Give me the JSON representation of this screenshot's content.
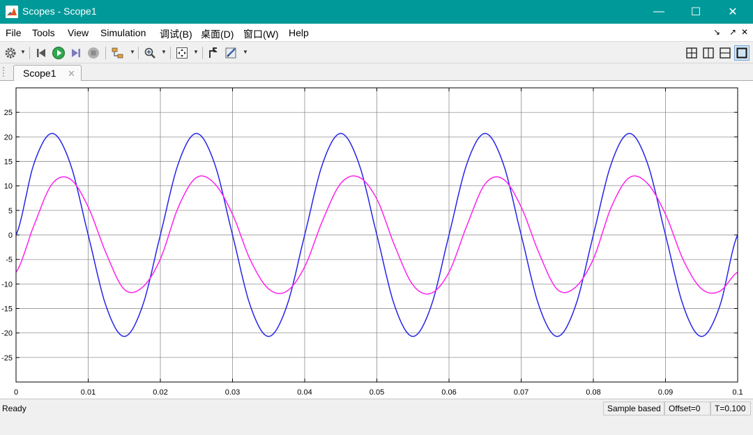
{
  "window": {
    "title": "Scopes - Scope1",
    "minimize_glyph": "—",
    "maximize_glyph": "☐",
    "close_glyph": "✕",
    "accent_color": "#009999"
  },
  "menu": {
    "items": [
      "File",
      "Tools",
      "View",
      "Simulation",
      "调试(B)",
      "桌面(D)",
      "窗口(W)",
      "Help"
    ],
    "right_glyphs": [
      "↘",
      "↗",
      "✕"
    ]
  },
  "toolbar": {
    "icons": [
      "gear-icon",
      "step-back-icon",
      "run-icon",
      "step-forward-icon",
      "stop-icon",
      "highlight-icon",
      "zoom-icon",
      "fit-to-view-icon",
      "triggers-icon",
      "measurements-icon"
    ],
    "layout_icons": [
      "layout-2x2-icon",
      "layout-columns-icon",
      "layout-rows-icon",
      "layout-single-icon"
    ]
  },
  "tab": {
    "label": "Scope1",
    "close_glyph": "✕"
  },
  "status": {
    "ready": "Ready",
    "sample_mode": "Sample based",
    "offset": "Offset=0",
    "time": "T=0.100"
  },
  "chart_data": {
    "type": "line",
    "title": "",
    "xlabel": "",
    "ylabel": "",
    "xlim": [
      0,
      0.1
    ],
    "ylim": [
      -30,
      30
    ],
    "xticks": [
      0,
      0.01,
      0.02,
      0.03,
      0.04,
      0.05,
      0.06,
      0.07,
      0.08,
      0.09,
      0.1
    ],
    "xtick_labels": [
      "0",
      "0.01",
      "0.02",
      "0.03",
      "0.04",
      "0.05",
      "0.06",
      "0.07",
      "0.08",
      "0.09",
      "0.1"
    ],
    "yticks": [
      -25,
      -20,
      -15,
      -10,
      -5,
      0,
      5,
      10,
      15,
      20,
      25
    ],
    "ytick_labels": [
      "-25",
      "-20",
      "-15",
      "-10",
      "-5",
      "0",
      "5",
      "10",
      "15",
      "20",
      "25"
    ],
    "grid": true,
    "background": "#ffffff",
    "series": [
      {
        "color": "#2424e8",
        "x": [
          0,
          0.0025,
          0.005,
          0.0075,
          0.01,
          0.0125,
          0.015,
          0.0175,
          0.02,
          0.0225,
          0.025,
          0.0275,
          0.03,
          0.0325,
          0.035,
          0.0375,
          0.04,
          0.0425,
          0.045,
          0.0475,
          0.05,
          0.0525,
          0.055,
          0.0575,
          0.06,
          0.0625,
          0.065,
          0.0675,
          0.07,
          0.0725,
          0.075,
          0.0775,
          0.08,
          0.0825,
          0.085,
          0.0875,
          0.09,
          0.0925,
          0.095,
          0.0975,
          0.1
        ],
        "y": [
          0,
          14.6,
          20.7,
          14.6,
          0,
          -14.6,
          -20.7,
          -14.6,
          0,
          14.6,
          20.7,
          14.6,
          0,
          -14.6,
          -20.7,
          -14.6,
          0,
          14.6,
          20.7,
          14.6,
          0,
          -14.6,
          -20.7,
          -14.6,
          0,
          14.6,
          20.7,
          14.6,
          0,
          -14.6,
          -20.7,
          -14.6,
          0,
          14.6,
          20.7,
          14.6,
          0,
          -14.6,
          -20.7,
          -14.6,
          0
        ]
      },
      {
        "color": "#ff22ee",
        "x": [
          0,
          0.0025,
          0.005,
          0.0075,
          0.01,
          0.0125,
          0.015,
          0.0175,
          0.02,
          0.0225,
          0.025,
          0.0275,
          0.03,
          0.0325,
          0.035,
          0.0375,
          0.04,
          0.0425,
          0.045,
          0.0475,
          0.05,
          0.0525,
          0.055,
          0.0575,
          0.06,
          0.0625,
          0.065,
          0.0675,
          0.07,
          0.0725,
          0.075,
          0.0775,
          0.08,
          0.0825,
          0.085,
          0.0875,
          0.09,
          0.0925,
          0.095,
          0.0975,
          0.1
        ],
        "y": [
          -7.6,
          2.0,
          10.4,
          11.4,
          5.7,
          -3.8,
          -11.1,
          -10.7,
          -4.9,
          5.7,
          11.7,
          10.5,
          4.2,
          -5.2,
          -11.0,
          -11.5,
          -6.5,
          3.0,
          10.5,
          11.8,
          7.3,
          -2.3,
          -10.2,
          -11.9,
          -7.6,
          2.0,
          10.4,
          11.4,
          5.7,
          -3.8,
          -11.1,
          -10.7,
          -4.9,
          5.7,
          11.7,
          10.5,
          4.2,
          -5.2,
          -11.0,
          -11.5,
          -7.6
        ]
      }
    ]
  }
}
